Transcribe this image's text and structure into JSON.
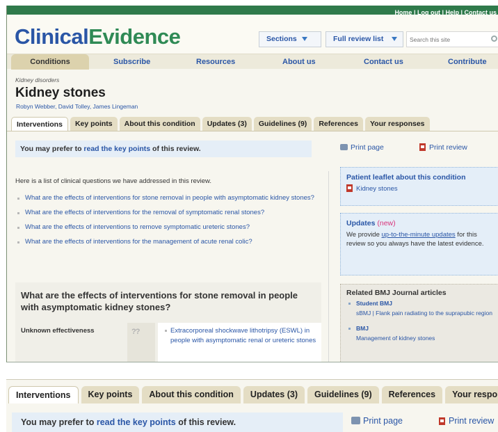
{
  "topbar": {
    "links": "Home | Log out | Help | Contact us"
  },
  "brand": {
    "part1": "Clinical",
    "part2": "Evidence"
  },
  "header": {
    "sections_label": "Sections",
    "full_review_label": "Full review list",
    "search_placeholder": "Search this site"
  },
  "mainnav": [
    "Conditions",
    "Subscribe",
    "Resources",
    "About us",
    "Contact us",
    "Contribute"
  ],
  "page": {
    "breadcrumb": "Kidney disorders",
    "title": "Kidney stones",
    "authors": "Robyn Webber, David Tolley, James Lingeman"
  },
  "subtabs": [
    "Interventions",
    "Key points",
    "About this condition",
    "Updates (3)",
    "Guidelines (9)",
    "References",
    "Your responses"
  ],
  "prefer": {
    "pre": "You may prefer to ",
    "link": "read the key points",
    "post": " of this review."
  },
  "print": {
    "page": "Print page",
    "review": "Print review"
  },
  "intro": "Here is a list of clinical questions we have addressed in this review.",
  "questions": [
    "What are the effects of interventions for stone removal in people with asymptomatic kidney stones?",
    "What are the effects of interventions for the removal of symptomatic renal stones?",
    "What are the effects of interventions to remove symptomatic ureteric stones?",
    "What are the effects of interventions for the management of acute renal colic?"
  ],
  "question_box": {
    "heading": "What are the effects of interventions for stone removal in people with asymptomatic kidney stones?",
    "category": "Unknown effectiveness",
    "icon_text": "??",
    "intervention": "Extracorporeal shockwave lithotripsy (ESWL) in people with asymptomatic renal or ureteric stones"
  },
  "sidebar": {
    "leaflet_title": "Patient leaflet about this condition",
    "leaflet_link": "Kidney stones",
    "updates_title": "Updates",
    "updates_new": "(new)",
    "updates_pre": "We provide ",
    "updates_link": "up-to-the-minute updates",
    "updates_post": " for this review so you always have the latest evidence.",
    "related_title": "Related BMJ Journal articles",
    "related": [
      {
        "source": "Student BMJ",
        "title": "sBMJ | Flank pain radiating to the suprapubic region"
      },
      {
        "source": "BMJ",
        "title": "Management of kidney stones"
      }
    ]
  },
  "colors": {
    "brand_blue": "#2a56a6",
    "brand_green": "#2f8a55",
    "topbar": "#2f7a4b",
    "tab_bg": "#e4ddc4"
  }
}
